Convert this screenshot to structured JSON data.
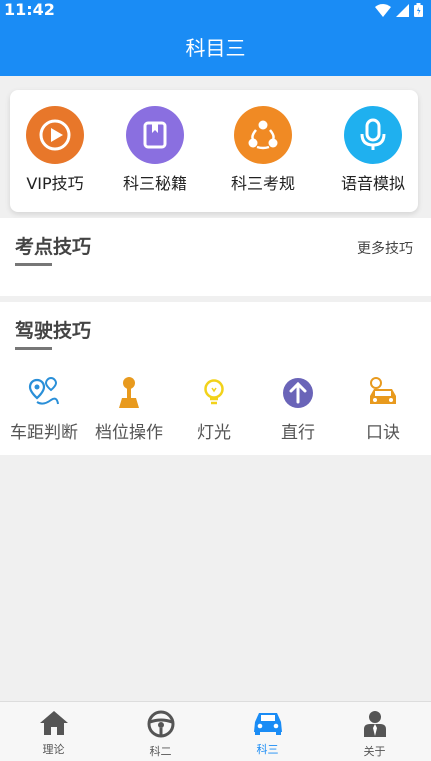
{
  "status_bar": {
    "time": "11:42"
  },
  "header": {
    "title": "科目三"
  },
  "quick_links": [
    {
      "label": "VIP技巧",
      "color": "#e8772a",
      "icon": "play-circle-icon"
    },
    {
      "label": "科三秘籍",
      "color": "#8a6fe0",
      "icon": "book-icon"
    },
    {
      "label": "科三考规",
      "color": "#f08a24",
      "icon": "share-icon"
    },
    {
      "label": "语音模拟",
      "color": "#1fb0ef",
      "icon": "microphone-icon"
    }
  ],
  "exam_tips": {
    "heading": "考点技巧",
    "more_label": "更多技巧"
  },
  "driving_tips": {
    "heading": "驾驶技巧",
    "items": [
      {
        "label": "车距判断",
        "icon": "location-pins-icon"
      },
      {
        "label": "档位操作",
        "icon": "gear-stick-icon"
      },
      {
        "label": "灯光",
        "icon": "light-bulb-icon"
      },
      {
        "label": "直行",
        "icon": "arrow-up-icon"
      },
      {
        "label": "口诀",
        "icon": "car-icon"
      }
    ]
  },
  "tab_bar": {
    "items": [
      {
        "label": "理论",
        "icon": "home-icon"
      },
      {
        "label": "科二",
        "icon": "steering-wheel-icon"
      },
      {
        "label": "科三",
        "icon": "car-icon",
        "active": true
      },
      {
        "label": "关于",
        "icon": "user-icon"
      }
    ]
  },
  "colors": {
    "primary": "#1a8cf5",
    "background": "#f0f0f0"
  }
}
